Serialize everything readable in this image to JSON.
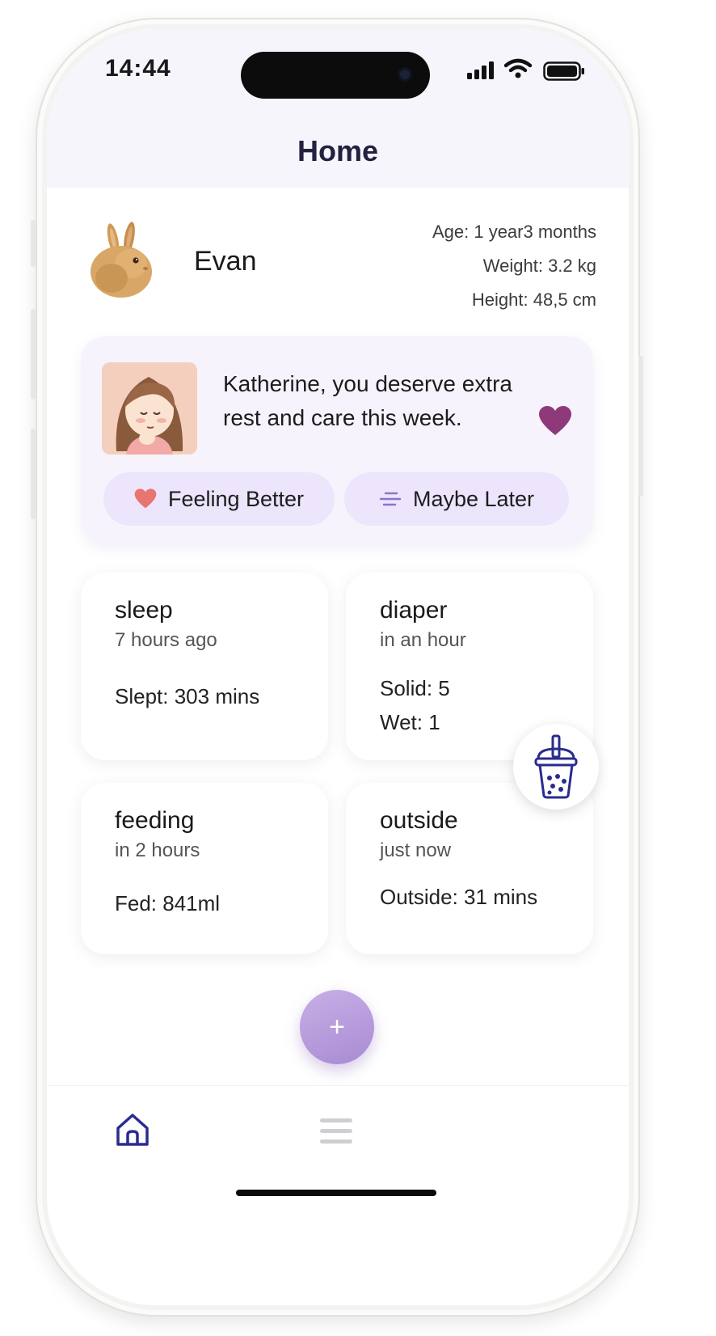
{
  "status_bar": {
    "time": "14:44"
  },
  "header": {
    "title": "Home"
  },
  "child": {
    "name": "Evan",
    "age": "Age: 1 year3 months",
    "weight": "Weight: 3.2 kg",
    "height": "Height: 48,5 cm",
    "avatar_icon": "bunny-avatar-icon"
  },
  "care_card": {
    "message": "Katherine, you deserve extra rest and care this week.",
    "feeling_better_label": "Feeling Better",
    "maybe_later_label": "Maybe Later",
    "avatar_icon": "mother-avatar-icon",
    "heart_color": "#8e3a7a",
    "feeling_heart_color": "#e8756f"
  },
  "tiles": {
    "sleep": {
      "title": "sleep",
      "subtitle": "7 hours ago",
      "values": [
        "Slept: 303 mins"
      ]
    },
    "diaper": {
      "title": "diaper",
      "subtitle": "in an hour",
      "values": [
        "Solid: 5",
        "Wet: 1"
      ]
    },
    "feeding": {
      "title": "feeding",
      "subtitle": "in 2 hours",
      "values": [
        "Fed: 841ml"
      ]
    },
    "outside": {
      "title": "outside",
      "subtitle": "just now",
      "values": [
        "Outside: 31 mins"
      ]
    }
  },
  "floating": {
    "boba_icon": "bubble-tea-icon",
    "add_label": "+"
  },
  "tabbar": {
    "home_icon": "home-icon",
    "menu_icon": "menu-icon",
    "accent": "#2a2b8f"
  }
}
